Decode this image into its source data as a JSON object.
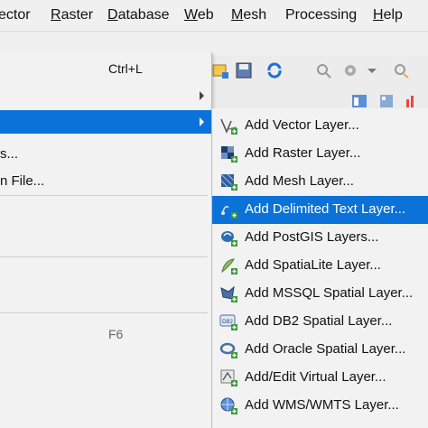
{
  "menubar": {
    "items": [
      {
        "label": "ector",
        "u": ""
      },
      {
        "label": "aster",
        "u": "R"
      },
      {
        "label": "atabase",
        "u": "D"
      },
      {
        "label": "eb",
        "u": "W"
      },
      {
        "label": "esh",
        "u": "M"
      },
      {
        "label": "Processing",
        "u": ""
      },
      {
        "label": "elp",
        "u": "H"
      }
    ]
  },
  "layer_menu": {
    "items": [
      {
        "label": "",
        "shortcut": "Ctrl+L"
      },
      {
        "label": "",
        "shortcut": ""
      },
      {
        "label": "",
        "shortcut": ""
      },
      {
        "label": "s...",
        "shortcut": ""
      },
      {
        "label": "n File...",
        "shortcut": ""
      },
      {
        "label": "",
        "shortcut": "F6"
      }
    ]
  },
  "add_layer_submenu": {
    "items": [
      {
        "label": "Add Vector Layer...",
        "icon": "vector-layer-icon"
      },
      {
        "label": "Add Raster Layer...",
        "icon": "raster-layer-icon"
      },
      {
        "label": "Add Mesh Layer...",
        "icon": "mesh-layer-icon"
      },
      {
        "label": "Add Delimited Text Layer...",
        "icon": "delimited-text-icon"
      },
      {
        "label": "Add PostGIS Layers...",
        "icon": "postgis-icon"
      },
      {
        "label": "Add SpatiaLite Layer...",
        "icon": "spatialite-icon"
      },
      {
        "label": "Add MSSQL Spatial Layer...",
        "icon": "mssql-icon"
      },
      {
        "label": "Add DB2 Spatial Layer...",
        "icon": "db2-icon"
      },
      {
        "label": "Add Oracle Spatial Layer...",
        "icon": "oracle-icon"
      },
      {
        "label": "Add/Edit Virtual Layer...",
        "icon": "virtual-layer-icon"
      },
      {
        "label": "Add WMS/WMTS Layer...",
        "icon": "wms-icon"
      }
    ],
    "highlighted_index": 3
  },
  "colors": {
    "highlight": "#0a72d8"
  }
}
